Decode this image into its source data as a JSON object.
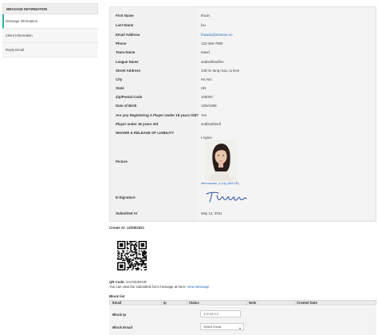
{
  "sidebar": {
    "header": "MESSAGE INFORMATION",
    "items": [
      {
        "label": "Message Information"
      },
      {
        "label": "Client Information"
      },
      {
        "label": "Reply Email"
      }
    ]
  },
  "details": [
    {
      "label": "First Name",
      "value": "thuan"
    },
    {
      "label": "Last Name",
      "value": "luu"
    },
    {
      "label": "Email Address",
      "value": "thuanlu@toranoe.vn"
    },
    {
      "label": "Phone",
      "value": "123-456-7890"
    },
    {
      "label": "Team Name",
      "value": "teasd"
    },
    {
      "label": "League Name",
      "value": "asdasdfasdfee"
    },
    {
      "label": "Street Address",
      "value": "136 ho tung mau, tu liem"
    },
    {
      "label": "City",
      "value": "Ha Noi"
    },
    {
      "label": "State",
      "value": "HN"
    },
    {
      "label": "Zip/Postal Code",
      "value": "100000"
    },
    {
      "label": "Date of Birth",
      "value": "10/5/1988"
    },
    {
      "label": "Are you Registering A Player Under 18 years Old?",
      "value": "Yes"
    },
    {
      "label": "Player under 18 years old",
      "value": "asdfasdfasdf"
    },
    {
      "label": "WAIVER & RELEASE OF LIABILITY",
      "value": "I Agree"
    },
    {
      "label": "Picture",
      "value": ""
    },
    {
      "label": "E-Signature",
      "value": ""
    },
    {
      "label": "Submitted At",
      "value": "May 12, 2021"
    }
  ],
  "picture_caption": "demoavatar_4.png (484 KB)",
  "signature_text": "Thuan",
  "created_at": "Create At: 12/05/2021",
  "qr": {
    "code_label": "QR Code:",
    "code_value": "2AC5D4NGR",
    "note": "You can view the submitted form message at here:",
    "link": "View Message"
  },
  "block_list": {
    "title": "Block list",
    "columns": [
      "Email",
      "Ip",
      "Status",
      "Note",
      "Created Date"
    ]
  },
  "block_form": {
    "ip_label": "Block Ip",
    "ip_value": "172.22.0.2",
    "email_label": "Block Email",
    "email_value": "Select Email"
  },
  "colors": {
    "accent": "#29b6a3",
    "link": "#2a6db5"
  }
}
